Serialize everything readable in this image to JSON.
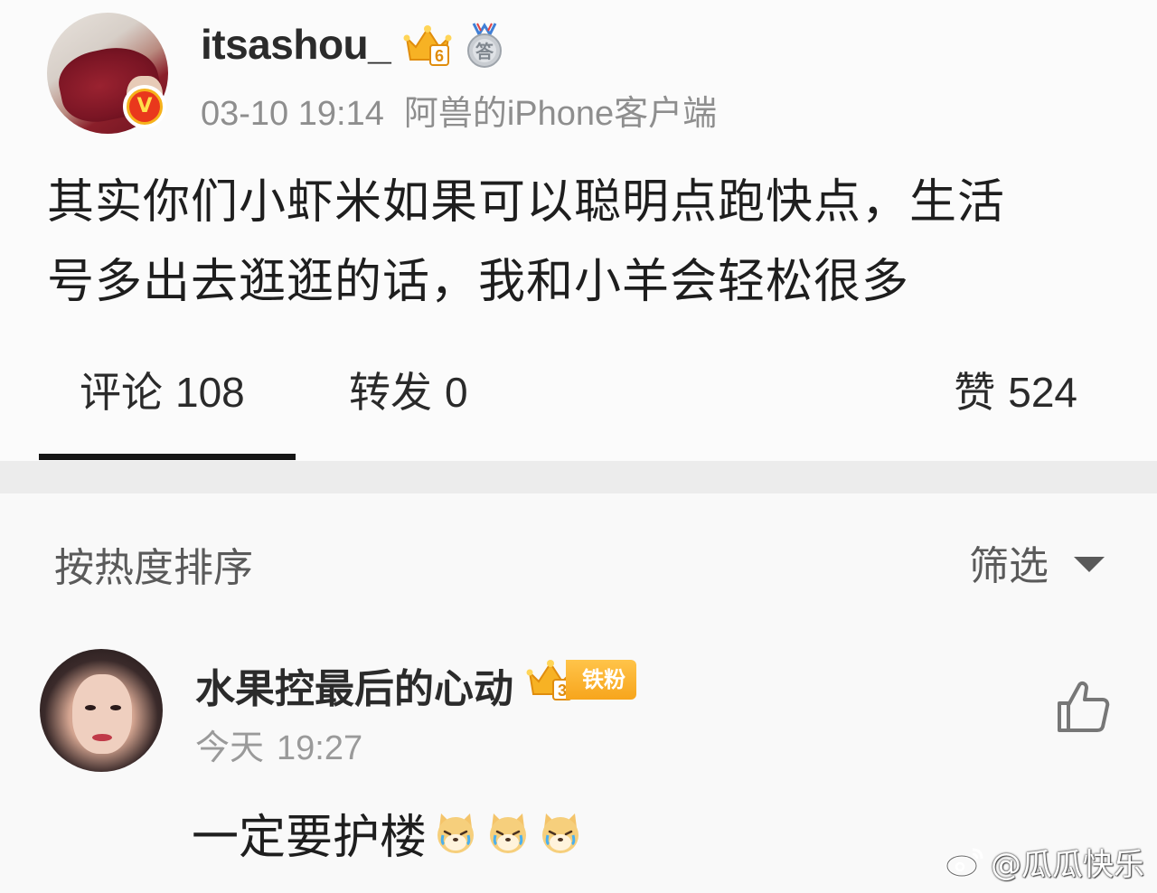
{
  "post": {
    "username": "itsashou_",
    "crown_level": "6",
    "medal_char": "答",
    "verified_mark": "V",
    "time": "03-10 19:14",
    "source": "阿兽的iPhone客户端",
    "body_line1": "其实你们小虾米如果可以聪明点跑快点，生活",
    "body_line2": "号多出去逛逛的话，我和小羊会轻松很多"
  },
  "tabs": {
    "comments_label": "评论",
    "comments_count": "108",
    "reposts_label": "转发",
    "reposts_count": "0",
    "likes_label": "赞",
    "likes_count": "524"
  },
  "comments_section": {
    "sort_label": "按热度排序",
    "filter_label": "筛选"
  },
  "comment": {
    "username": "水果控最后的心动",
    "crown_level": "3",
    "fan_badge": "铁粉",
    "date_label": "今天",
    "time": "19:27",
    "text": "一定要护楼"
  },
  "watermark": {
    "text": "@瓜瓜快乐"
  },
  "colors": {
    "accent_orange": "#f7a51c",
    "verified_red": "#e9381c",
    "text_dark": "#1e1e1e",
    "text_muted": "#8e8e8e"
  }
}
